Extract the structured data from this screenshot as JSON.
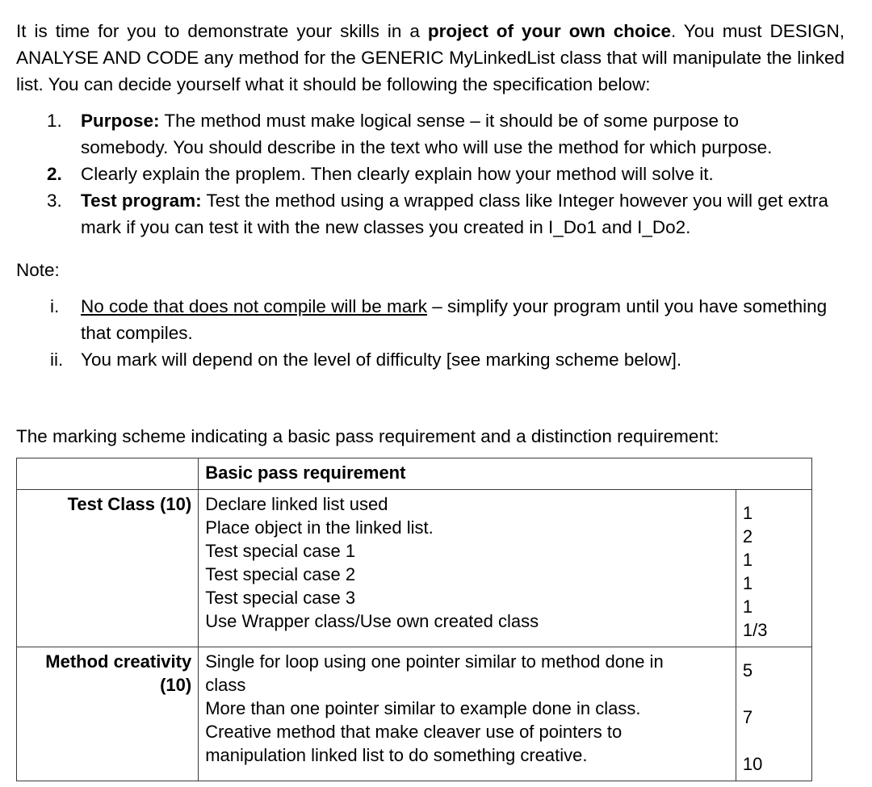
{
  "document": {
    "intro": {
      "part1": "It is time for you to demonstrate your skills in a ",
      "bold1": "project of your own choice",
      "part2": ". You must DESIGN, ANALYSE AND CODE any method for the GENERIC MyLinkedList class that will manipulate the linked list. You can decide yourself what it should be following the specification below:"
    },
    "requirements": [
      {
        "marker": "1.",
        "marker_bold": false,
        "lead": "Purpose:",
        "lead_bold": true,
        "text": " The method must make logical sense – it should be of some purpose to somebody. You should describe in the text who will use the method for which purpose."
      },
      {
        "marker": "2.",
        "marker_bold": true,
        "lead": "",
        "lead_bold": false,
        "text": "Clearly explain the proplem. Then clearly explain how your method will solve it."
      },
      {
        "marker": "3.",
        "marker_bold": false,
        "lead": "Test program:",
        "lead_bold": true,
        "text": " Test the method using a wrapped class like Integer however you will get extra mark if you can test it with the new classes you created in I_Do1 and I_Do2."
      }
    ],
    "note_label": "Note:",
    "notes": [
      {
        "marker": "i.",
        "underlined": "No code that does not compile will be mark",
        "text": " – simplify your program until you have something that compiles."
      },
      {
        "marker": "ii.",
        "underlined": "",
        "text": "You mark will depend on the level of difficulty [see marking scheme below]."
      }
    ],
    "scheme_intro": "The marking scheme indicating a basic pass requirement and a distinction requirement:",
    "table": {
      "header": {
        "category": "",
        "requirement": "Basic pass requirement"
      },
      "rows": [
        {
          "category": "Test Class (10)",
          "descriptions": [
            "Declare linked list used",
            "Place object in the linked list.",
            "Test special case 1",
            "Test special case 2",
            "Test special case 3",
            "Use Wrapper class/Use own created class"
          ],
          "marks": [
            "1",
            "2",
            "1",
            "1",
            "1",
            "1/3"
          ]
        },
        {
          "category": "Method creativity (10)",
          "category_line1": "Method creativity",
          "category_line2": "(10)",
          "descriptions": [
            "Single for loop using one pointer similar to method done in",
            "class",
            "More than one pointer similar to example done in class.",
            "Creative method that make cleaver use of pointers to",
            "manipulation linked list to do something creative."
          ],
          "marks": [
            "5",
            "",
            "7",
            "",
            "10"
          ]
        }
      ]
    }
  },
  "colors": {
    "text": "#000000",
    "border": "#3a3a3a",
    "background": "#ffffff"
  }
}
